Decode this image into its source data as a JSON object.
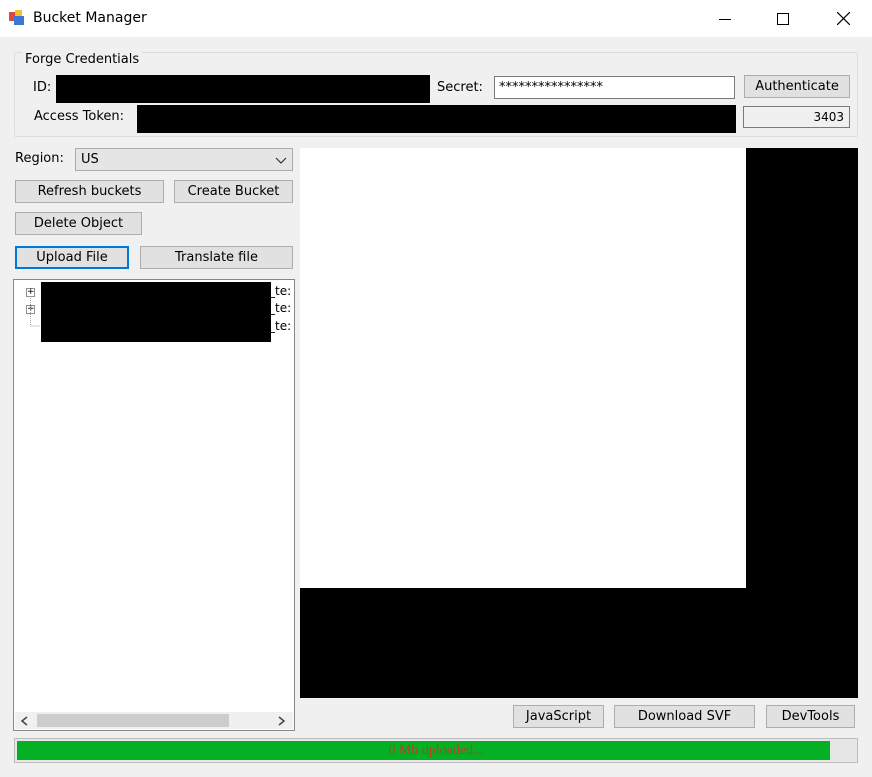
{
  "window": {
    "title": "Bucket Manager",
    "icon": "app-window-icon"
  },
  "credentials": {
    "group_title": "Forge Credentials",
    "id_label": "ID:",
    "secret_label": "Secret:",
    "secret_value": "****************",
    "authenticate_label": "Authenticate",
    "access_token_label": "Access Token:",
    "expires_value": "3403"
  },
  "sidebar": {
    "region_label": "Region:",
    "region_value": "US",
    "refresh_label": "Refresh buckets",
    "create_label": "Create Bucket",
    "delete_label": "Delete Object",
    "upload_label": "Upload File",
    "translate_label": "Translate file",
    "tree_items": [
      {
        "suffix": "_te:",
        "expandable": true
      },
      {
        "suffix": "_te:",
        "expandable": true
      },
      {
        "suffix": "_te:",
        "expandable": false
      }
    ]
  },
  "bottom_buttons": {
    "javascript_label": "JavaScript",
    "download_svf_label": "Download SVF",
    "devtools_label": "DevTools"
  },
  "progress": {
    "text": "0 Mb uploaded...",
    "fraction": 0.97,
    "fill_color": "#06b025",
    "text_color": "#c0392b"
  }
}
